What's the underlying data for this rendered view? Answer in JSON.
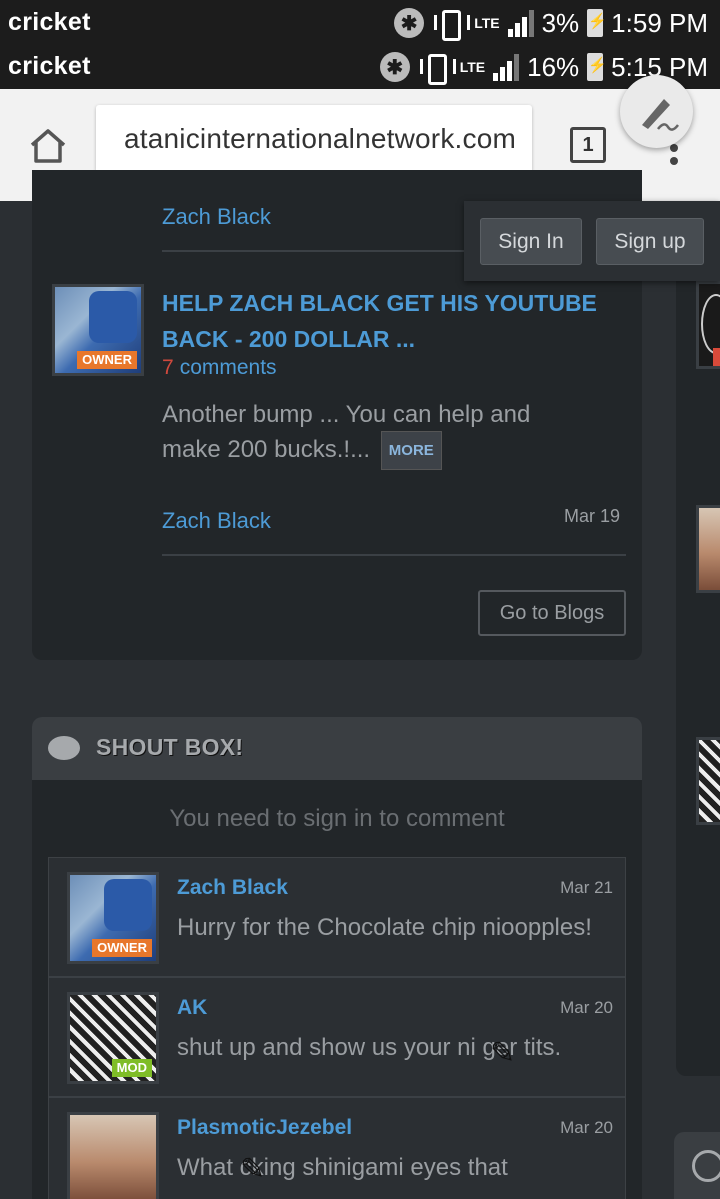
{
  "status_bars": [
    {
      "carrier": "cricket",
      "lte": "LTE",
      "battery": "3%",
      "time": "1:59 PM"
    },
    {
      "carrier": "cricket",
      "lte": "LTE",
      "battery": "16%",
      "time": "5:15 PM"
    }
  ],
  "browser": {
    "url": "atanicinternationalnetwork.com",
    "tab_count": "1"
  },
  "auth": {
    "sign_in": "Sign In",
    "sign_up": "Sign up"
  },
  "blogs": {
    "prev_author": "Zach Black",
    "post": {
      "title": "HELP ZACH BLACK GET HIS YOUTUBE BACK - 200 DOLLAR ...",
      "comment_count": "7",
      "comments_label": "comments",
      "excerpt": "Another bump ... You can help and make 200 bucks.!...",
      "more_label": "MORE",
      "author": "Zach Black",
      "date": "Mar 19",
      "badge": "OWNER"
    },
    "go_to_blogs": "Go to Blogs"
  },
  "shoutbox": {
    "title": "SHOUT BOX!",
    "signin_note": "You need to sign in to comment",
    "items": [
      {
        "name": "Zach Black",
        "date": "Mar 21",
        "text": "Hurry for the Chocolate chip nioopples!",
        "badge": "OWNER"
      },
      {
        "name": "AK",
        "date": "Mar 20",
        "text": "shut up and show us your ni   ger tits.",
        "badge": "MOD"
      },
      {
        "name": "PlasmoticJezebel",
        "date": "Mar 20",
        "text": "What   cking shinigami eyes that",
        "badge": ""
      }
    ]
  },
  "icons": [
    "bluetooth-icon",
    "vibrate-icon",
    "signal-icon",
    "battery-icon",
    "home-icon",
    "menu-icon",
    "edit-icon",
    "chat-icon",
    "clock-icon"
  ]
}
